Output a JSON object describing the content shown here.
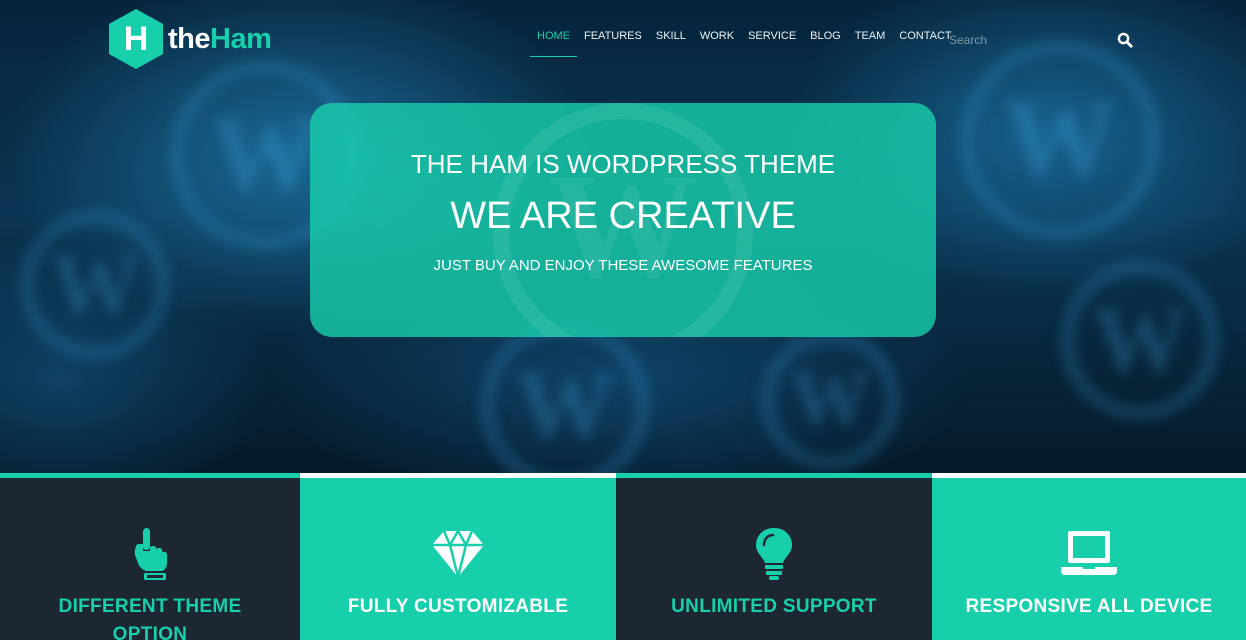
{
  "brand": {
    "letter": "H",
    "name_part1": "the",
    "name_part2": "Ham"
  },
  "nav": {
    "items": [
      {
        "label": "HOME",
        "active": true
      },
      {
        "label": "FEATURES",
        "active": false
      },
      {
        "label": "SKILL",
        "active": false
      },
      {
        "label": "WORK",
        "active": false
      },
      {
        "label": "SERVICE",
        "active": false
      },
      {
        "label": "BLOG",
        "active": false
      },
      {
        "label": "TEAM",
        "active": false
      },
      {
        "label": "CONTACT",
        "active": false
      }
    ],
    "search_placeholder": "Search",
    "search_icon": "search-icon"
  },
  "hero": {
    "line1": "THE HAM IS WORDPRESS THEME",
    "line2": "WE ARE CREATIVE",
    "line3": "JUST BUY AND ENJOY THESE AWESOME FEATURES"
  },
  "features": [
    {
      "icon": "pointing-hand-icon",
      "title_line1": "DIFFERENT THEME",
      "title_line2": "OPTION",
      "style": "dark"
    },
    {
      "icon": "diamond-icon",
      "title_line1": "FULLY CUSTOMIZABLE",
      "title_line2": "",
      "style": "teal"
    },
    {
      "icon": "lightbulb-icon",
      "title_line1": "UNLIMITED SUPPORT",
      "title_line2": "",
      "style": "dark"
    },
    {
      "icon": "laptop-icon",
      "title_line1": "RESPONSIVE ALL DEVICE",
      "title_line2": "",
      "style": "teal"
    }
  ],
  "colors": {
    "accent": "#18cfab",
    "dark": "#1d2731",
    "white": "#ffffff"
  }
}
